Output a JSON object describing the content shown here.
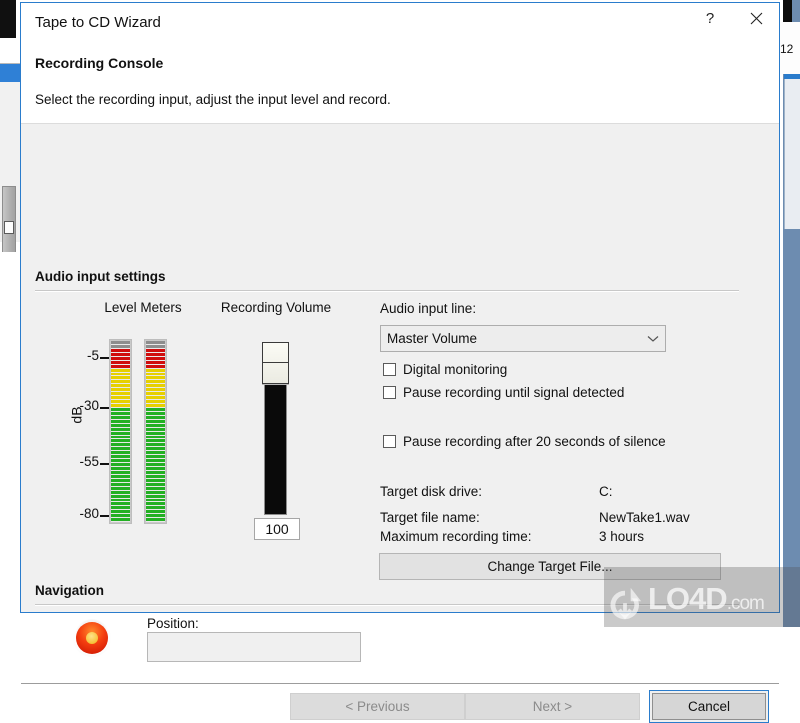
{
  "window": {
    "title": "Tape to CD Wizard",
    "help_label": "?",
    "close_label": "✕",
    "subtitle": "Recording Console",
    "description": "Select the recording input, adjust the input level and record."
  },
  "groups": {
    "audio_input_settings": "Audio input settings",
    "navigation": "Navigation"
  },
  "meters": {
    "title": "Level Meters",
    "axis_label": "dB",
    "ticks": [
      "-5",
      "-30",
      "-55",
      "-80"
    ],
    "colors": {
      "gray": "#8d8d8d",
      "red": "#d00d0d",
      "yellow": "#e6d000",
      "green": "#23b023"
    }
  },
  "volume": {
    "title": "Recording Volume",
    "value": "100"
  },
  "audio_input_line": {
    "label": "Audio input line:",
    "selected": "Master Volume",
    "options": [
      "Master Volume"
    ],
    "chevron": "⌄"
  },
  "checkboxes": [
    {
      "label": "Digital monitoring",
      "checked": false
    },
    {
      "label": "Pause recording until signal detected",
      "checked": false
    },
    {
      "label": "Pause recording after 20 seconds of silence",
      "checked": false
    }
  ],
  "target_info": [
    {
      "key": "Target disk drive:",
      "value": "C:"
    },
    {
      "key": "Target file name:",
      "value": "NewTake1.wav"
    },
    {
      "key": "Maximum recording time:",
      "value": "3 hours"
    }
  ],
  "change_target_button": "Change Target File...",
  "position": {
    "label": "Position:",
    "value": ""
  },
  "footer": {
    "previous": "< Previous",
    "next": "Next >",
    "cancel": "Cancel"
  },
  "background": {
    "right_window_fragment": "12"
  },
  "watermark": {
    "text": "LO4D",
    "suffix": ".com"
  }
}
